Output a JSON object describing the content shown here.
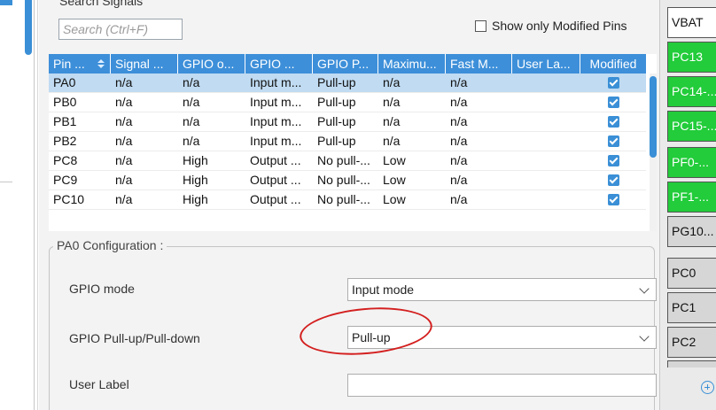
{
  "search": {
    "caption": "Search Signals",
    "placeholder": "Search (Ctrl+F)",
    "value": ""
  },
  "show_only_modified": {
    "label": "Show only Modified Pins",
    "checked": false
  },
  "table": {
    "columns": [
      "Pin ...",
      "Signal ...",
      "GPIO o...",
      "GPIO ...",
      "GPIO P...",
      "Maximu...",
      "Fast M...",
      "User La...",
      "Modified"
    ],
    "sorted_column": "Pin ...",
    "selected_row": 0,
    "rows": [
      {
        "pin": "PA0",
        "signal": "n/a",
        "gpio_output": "n/a",
        "gpio_mode": "Input m...",
        "gpio_pull": "Pull-up",
        "max_speed": "n/a",
        "fast_mode": "n/a",
        "user_label": "",
        "modified": true
      },
      {
        "pin": "PB0",
        "signal": "n/a",
        "gpio_output": "n/a",
        "gpio_mode": "Input m...",
        "gpio_pull": "Pull-up",
        "max_speed": "n/a",
        "fast_mode": "n/a",
        "user_label": "",
        "modified": true
      },
      {
        "pin": "PB1",
        "signal": "n/a",
        "gpio_output": "n/a",
        "gpio_mode": "Input m...",
        "gpio_pull": "Pull-up",
        "max_speed": "n/a",
        "fast_mode": "n/a",
        "user_label": "",
        "modified": true
      },
      {
        "pin": "PB2",
        "signal": "n/a",
        "gpio_output": "n/a",
        "gpio_mode": "Input m...",
        "gpio_pull": "Pull-up",
        "max_speed": "n/a",
        "fast_mode": "n/a",
        "user_label": "",
        "modified": true
      },
      {
        "pin": "PC8",
        "signal": "n/a",
        "gpio_output": "High",
        "gpio_mode": "Output ...",
        "gpio_pull": "No pull-...",
        "max_speed": "Low",
        "fast_mode": "n/a",
        "user_label": "",
        "modified": true
      },
      {
        "pin": "PC9",
        "signal": "n/a",
        "gpio_output": "High",
        "gpio_mode": "Output ...",
        "gpio_pull": "No pull-...",
        "max_speed": "Low",
        "fast_mode": "n/a",
        "user_label": "",
        "modified": true
      },
      {
        "pin": "PC10",
        "signal": "n/a",
        "gpio_output": "High",
        "gpio_mode": "Output ...",
        "gpio_pull": "No pull-...",
        "max_speed": "Low",
        "fast_mode": "n/a",
        "user_label": "",
        "modified": true
      }
    ]
  },
  "config": {
    "title": "PA0 Configuration :",
    "gpio_mode_label": "GPIO mode",
    "gpio_mode_value": "Input mode",
    "pull_label": "GPIO Pull-up/Pull-down",
    "pull_value": "Pull-up",
    "user_label_label": "User Label",
    "user_label_value": ""
  },
  "pins": [
    {
      "label": "VBAT",
      "state": "plain"
    },
    {
      "label": "PC13",
      "state": "green"
    },
    {
      "label": "PC14-...",
      "state": "green"
    },
    {
      "label": "PC15-...",
      "state": "green"
    },
    {
      "label": "PF0-...",
      "state": "green"
    },
    {
      "label": "PF1-...",
      "state": "green"
    },
    {
      "label": "PG10...",
      "state": "gray"
    },
    {
      "label": "PC0",
      "state": "gray"
    },
    {
      "label": "PC1",
      "state": "gray"
    },
    {
      "label": "PC2",
      "state": "gray"
    },
    {
      "label": "",
      "state": "gray"
    }
  ],
  "colors": {
    "accent": "#3d8fd9",
    "selected_row": "#c0dbf2",
    "pin_green": "#22cc3a",
    "annotation_red": "#d41f1f"
  }
}
